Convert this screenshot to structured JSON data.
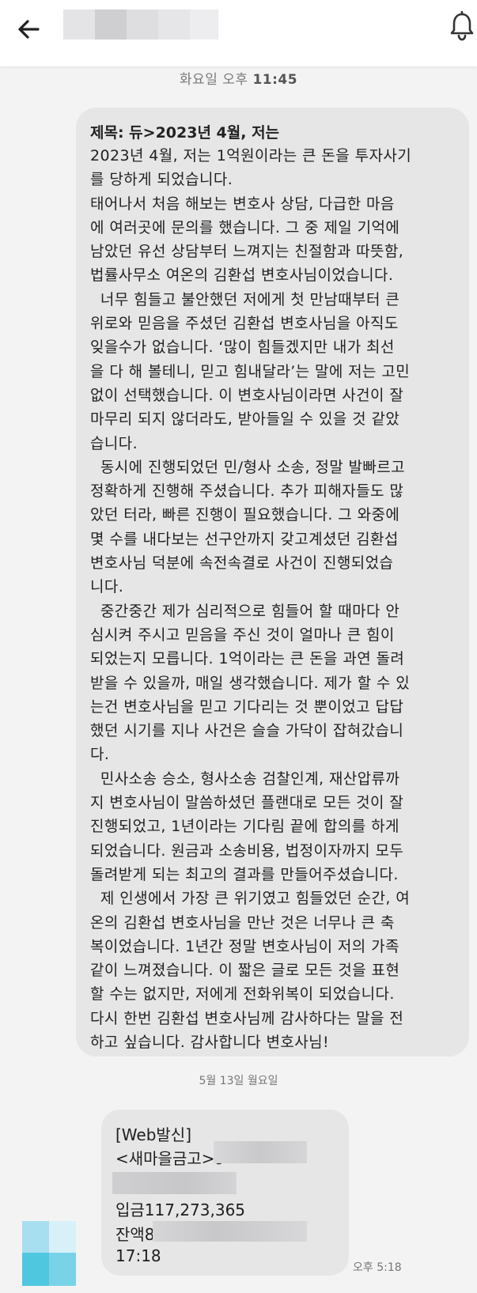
{
  "header": {
    "back_icon": "arrow-left-icon",
    "notification_icon": "bell-icon"
  },
  "messages_top": {
    "timestamp_day": "화요일 오후",
    "timestamp_time": "11:45"
  },
  "long_message": {
    "title": "제목: 듀>2023년 4월, 저는",
    "lines": [
      "2023년 4월, 저는 1억원이라는 큰 돈을 투자사기",
      "를 당하게 되었습니다.",
      "태어나서 처음 해보는 변호사 상담, 다급한 마음",
      "에 여러곳에 문의를 했습니다. 그 중 제일 기억에",
      "남았던 유선 상담부터 느껴지는 친절함과 따뜻함,",
      "법률사무소 여온의 김환섭 변호사님이었습니다.",
      "  너무 힘들고 불안했던 저에게 첫 만남때부터 큰",
      "위로와 믿음을 주셨던 김환섭 변호사님을 아직도",
      "잊을수가 없습니다. ‘많이 힘들겠지만 내가 최선",
      "을 다 해 볼테니, 믿고 힘내달라’는 말에 저는 고민",
      "없이 선택했습니다. 이 변호사님이라면 사건이 잘",
      "마무리 되지 않더라도, 받아들일 수 있을 것 같았",
      "습니다.",
      "  동시에 진행되었던 민/형사 소송, 정말 발빠르고",
      "정확하게 진행해 주셨습니다. 추가 피해자들도 많",
      "았던 터라, 빠른 진행이 필요했습니다. 그 와중에",
      "몇 수를 내다보는 선구안까지 갖고계셨던 김환섭",
      "변호사님 덕분에 속전속결로 사건이 진행되었습",
      "니다.",
      "  중간중간 제가 심리적으로 힘들어 할 때마다 안",
      "심시켜 주시고 믿음을 주신 것이 얼마나 큰 힘이",
      "되었는지 모릅니다. 1억이라는 큰 돈을 과연 돌려",
      "받을 수 있을까, 매일 생각했습니다. 제가 할 수 있",
      "는건 변호사님을 믿고 기다리는 것 뿐이었고 답답",
      "했던 시기를 지나 사건은 슬슬 가닥이 잡혀갔습니",
      "다.",
      "  민사소송 승소, 형사소송 검찰인계, 재산압류까",
      "지 변호사님이 말씀하셨던 플랜대로 모든 것이 잘",
      "진행되었고, 1년이라는 기다림 끝에 합의를 하게",
      "되었습니다. 원금과 소송비용, 법정이자까지 모두",
      "돌려받게 되는 최고의 결과를 만들어주셨습니다.",
      "  제 인생에서 가장 큰 위기였고 힘들었던 순간, 여",
      "온의 김환섭 변호사님을 만난 것은 너무나 큰 축",
      "복이었습니다. 1년간 정말 변호사님이 저의 가족",
      "같이 느껴졌습니다. 이 짧은 글로 모든 것을 표현",
      "할 수는 없지만, 저에게 전화위복이 되었습니다.",
      "다시 한번 김환섭 변호사님께 감사하다는 말을 전",
      "하고 싶습니다. 감사합니다 변호사님!"
    ]
  },
  "date_separator": "5월 13일 월요일",
  "sms_message": {
    "line1": "[Web발신]",
    "line2": "<새마을금고>9",
    "line3": "입금117,273,365",
    "line4": "잔액8",
    "line5": "17:18",
    "time": "오후 5:18"
  }
}
